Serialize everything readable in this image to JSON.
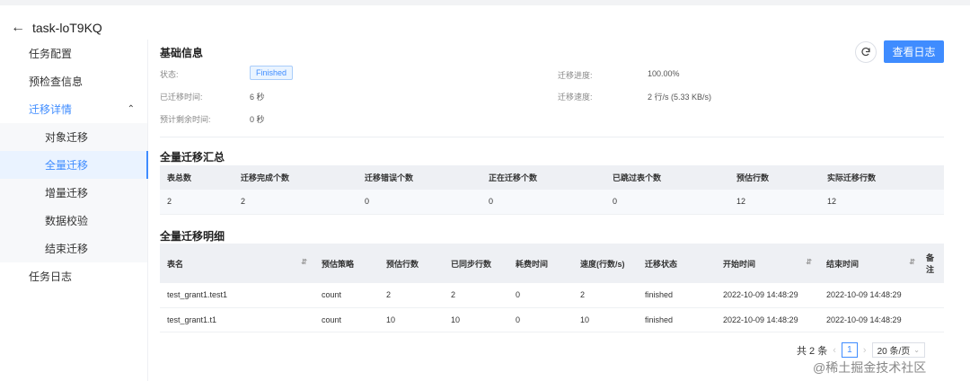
{
  "header": {
    "back_icon": "arrow-left-icon",
    "title": "task-loT9KQ"
  },
  "sidebar": {
    "items": [
      {
        "label": "任务配置"
      },
      {
        "label": "预检查信息"
      },
      {
        "label": "迁移详情",
        "expanded": true
      },
      {
        "label": "对象迁移"
      },
      {
        "label": "全量迁移",
        "active": true
      },
      {
        "label": "增量迁移"
      },
      {
        "label": "数据校验"
      },
      {
        "label": "结束迁移"
      },
      {
        "label": "任务日志"
      }
    ]
  },
  "toolbar": {
    "refresh_icon": "refresh-icon",
    "view_log_label": "查看日志"
  },
  "basic_info": {
    "title": "基础信息",
    "status_label": "状态:",
    "status_value": "Finished",
    "elapsed_label": "已迁移时间:",
    "elapsed_value": "6 秒",
    "remaining_label": "预计剩余时间:",
    "remaining_value": "0 秒",
    "progress_label": "迁移进度:",
    "progress_value": "100.00%",
    "speed_label": "迁移速度:",
    "speed_value": "2 行/s (5.33 KB/s)"
  },
  "summary": {
    "title": "全量迁移汇总",
    "columns": [
      "表总数",
      "迁移完成个数",
      "迁移错误个数",
      "正在迁移个数",
      "已跳过表个数",
      "预估行数",
      "实际迁移行数"
    ],
    "row": [
      "2",
      "2",
      "0",
      "0",
      "0",
      "12",
      "12"
    ]
  },
  "detail": {
    "title": "全量迁移明细",
    "columns": [
      "表名",
      "预估策略",
      "预估行数",
      "已同步行数",
      "耗费时间",
      "速度(行数/s)",
      "迁移状态",
      "开始时间",
      "结束时间",
      "备注"
    ],
    "rows": [
      [
        "test_grant1.test1",
        "count",
        "2",
        "2",
        "0",
        "2",
        "finished",
        "2022-10-09 14:48:29",
        "2022-10-09 14:48:29",
        ""
      ],
      [
        "test_grant1.t1",
        "count",
        "10",
        "10",
        "0",
        "10",
        "finished",
        "2022-10-09 14:48:29",
        "2022-10-09 14:48:29",
        ""
      ]
    ]
  },
  "pagination": {
    "total": "共 2 条",
    "current_page": "1",
    "page_size": "20 条/页"
  },
  "watermark": "@稀土掘金技术社区"
}
